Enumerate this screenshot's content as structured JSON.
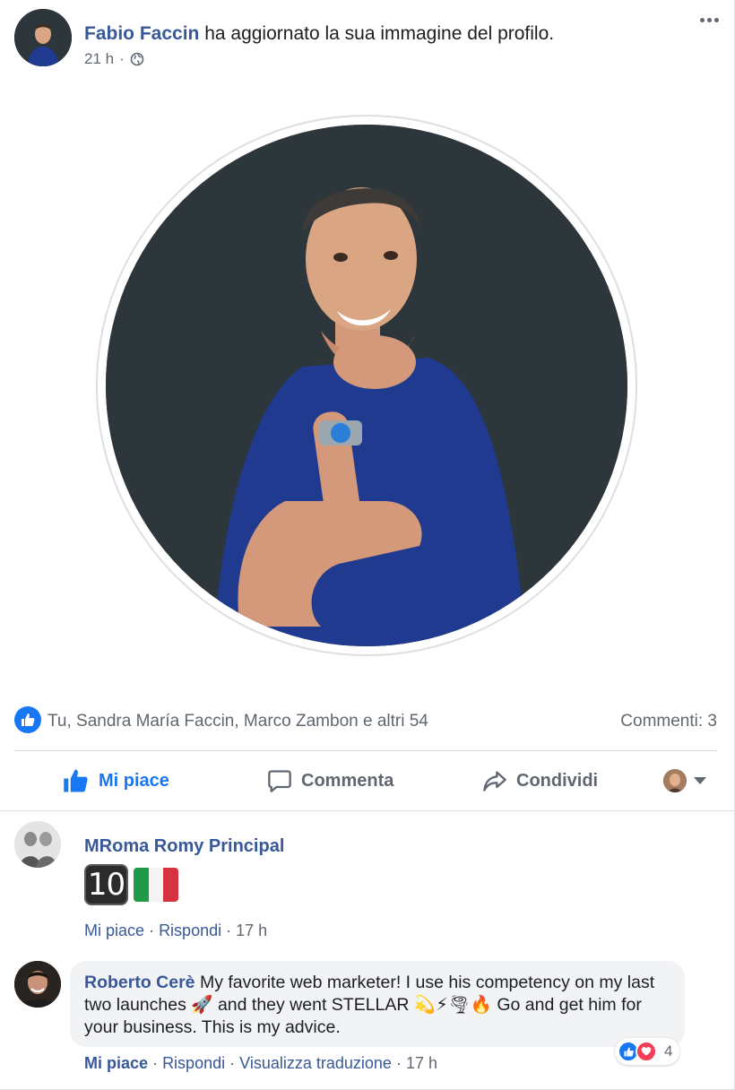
{
  "post": {
    "author": "Fabio Faccin",
    "action_text": " ha aggiornato la sua immagine del profilo.",
    "time": "21 h",
    "separator": "·",
    "audience_icon": "globe-icon",
    "more_icon": "more-horizontal-icon"
  },
  "stats": {
    "reaction_icon": "like-icon",
    "likes_text": "Tu, Sandra María Faccin, Marco Zambon e altri 54",
    "comments_text": "Commenti: 3"
  },
  "actions": {
    "like_label": "Mi piace",
    "comment_label": "Commenta",
    "share_label": "Condividi"
  },
  "comments": [
    {
      "author": "MRoma Romy Principal",
      "emojis": [
        "🔟",
        "🇮🇹"
      ],
      "emoji_ten_text": "10",
      "like_label": "Mi piace",
      "reply_label": "Rispondi",
      "time": "17 h",
      "sep": "·"
    },
    {
      "author": "Roberto Cerè",
      "text_part1": " My favorite web marketer! I use his competency on my last two launches ",
      "emoji_rocket": "🚀",
      "text_part2": " and they went STELLAR ",
      "emoji_stars": "💫⚡🌪🔥",
      "text_part3": " Go and get him for your business. This is my advice.",
      "like_label": "Mi piace",
      "reply_label": "Rispondi",
      "translate_label": "Visualizza traduzione",
      "time": "17 h",
      "sep": "·",
      "reaction_count": "4"
    }
  ],
  "colors": {
    "link_blue": "#385898",
    "fb_blue": "#1877f2",
    "meta_gray": "#606770",
    "bubble_bg": "#f2f3f5",
    "photo_bg": "#2d363b",
    "shirt_blue": "#1f3a8f"
  }
}
